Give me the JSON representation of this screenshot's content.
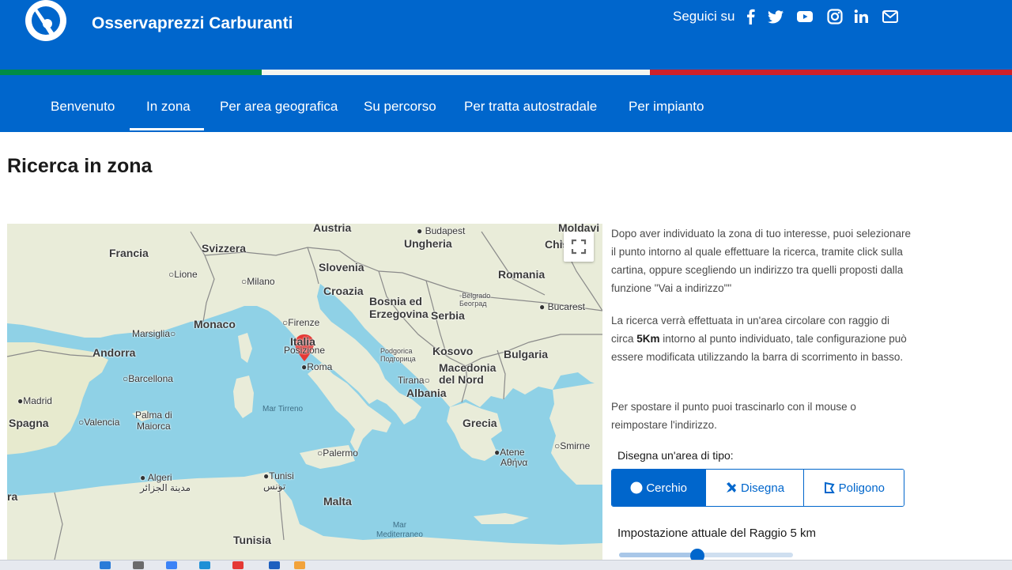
{
  "header": {
    "brand": "Osservaprezzi Carburanti",
    "follow_label": "Seguici su",
    "social_icons": [
      "facebook-icon",
      "twitter-icon",
      "youtube-icon",
      "instagram-icon",
      "linkedin-icon",
      "mail-icon"
    ],
    "primary_color": "#0066cc",
    "tricolor": [
      "#008c45",
      "#f4f5f0",
      "#cd212a"
    ]
  },
  "nav": {
    "items": [
      "Benvenuto",
      "In zona",
      "Per area geografica",
      "Su percorso",
      "Per tratta autostradale",
      "Per impianto"
    ],
    "active": "In zona"
  },
  "page": {
    "title": "Ricerca in zona"
  },
  "map": {
    "countries": [
      "Francia",
      "Svizzera",
      "Austria",
      "Ungheria",
      "Moldavi",
      "Slovenia",
      "Croazia",
      "Romania",
      "Bosnia ed Erzegovina",
      "Serbia",
      "Monaco",
      "Andorra",
      "Italia",
      "Kosovo",
      "Bulgaria",
      "Macedonia del Nord",
      "Albania",
      "Spagna",
      "Grecia",
      "Malta",
      "Tunisia",
      "Chiș"
    ],
    "cities": [
      "Budapest",
      "Lione",
      "Milano",
      "Belgrado",
      "Београд",
      "Bucarest",
      "Firenze",
      "Marsiglia",
      "Posizione",
      "Roma",
      "Podgorica",
      "Подгорица",
      "Tirana",
      "Barcellona",
      "Madrid",
      "Valencia",
      "Palma di Maiorca",
      "Palermo",
      "Atene",
      "Αθήνα",
      "Smirne",
      "Algeri",
      "مدينة الجزائر",
      "Tunisi",
      "تونس"
    ],
    "seas": [
      "Mar Tirreno",
      "Mar Mediterraneo"
    ],
    "edge_label": "ra",
    "marker": "Posizione",
    "fullscreen_icon": "fullscreen-icon"
  },
  "info": {
    "p1": "Dopo aver individuato la zona di tuo interesse, puoi selezionare il punto intorno al quale effettuare la ricerca, tramite click sulla cartina, oppure scegliendo un indirizzo tra quelli proposti dalla funzione \"Vai a indirizzo\"\"",
    "p2_a": "La ricerca verrà effettuata in un'area circolare con raggio di circa ",
    "p2_bold": "5Km",
    "p2_b": " intorno al punto individuato, tale configurazione può essere modificata utilizzando la barra di scorrimento in basso.",
    "p3": "Per spostare il punto puoi trascinarlo con il mouse o reimpostare l'indirizzo."
  },
  "draw": {
    "label": "Disegna un'area di tipo:",
    "options": [
      "Cerchio",
      "Disegna",
      "Poligono"
    ],
    "active": "Cerchio"
  },
  "radius": {
    "label": "Impostazione attuale del Raggio 5 km",
    "value_km": 5,
    "slider_fraction": 0.45
  }
}
